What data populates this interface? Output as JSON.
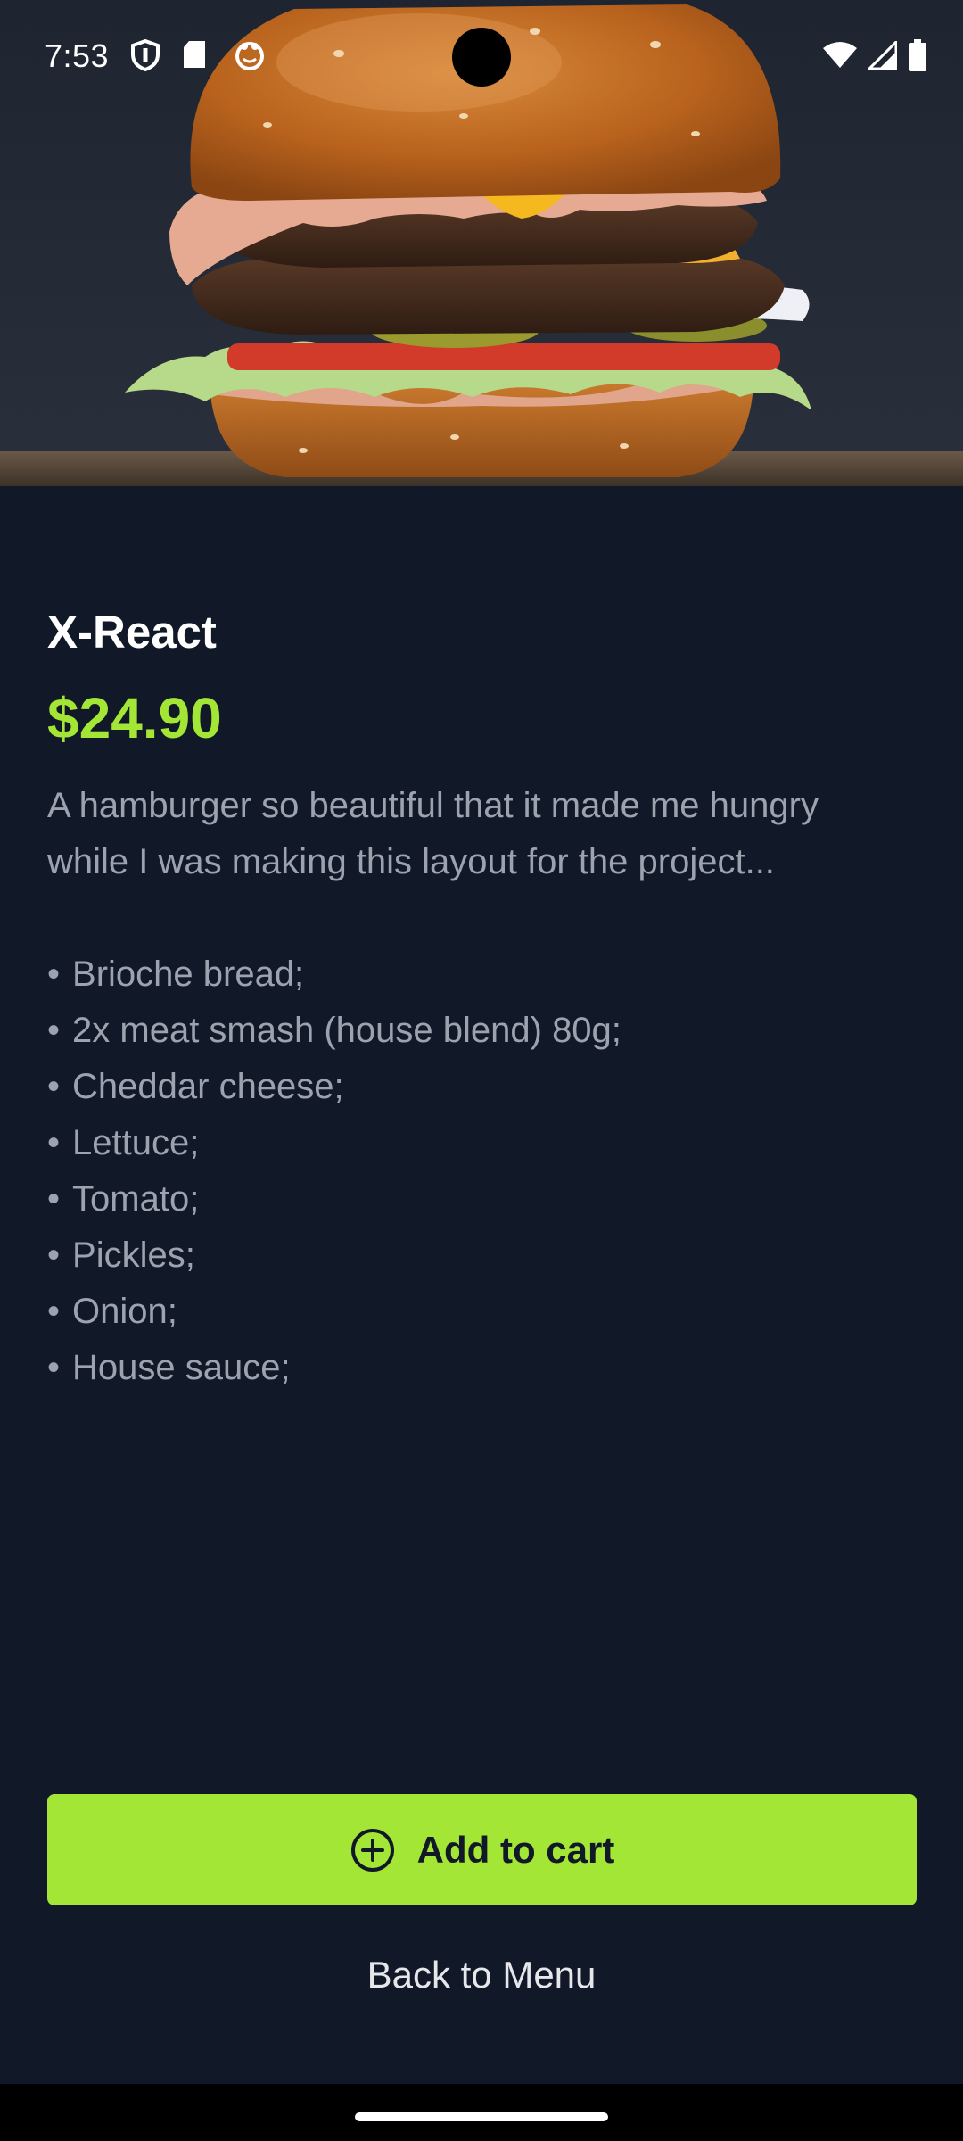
{
  "status_bar": {
    "time": "7:53",
    "left_icons": [
      "shield-icon",
      "sd-card-icon",
      "smiley-icon"
    ],
    "right_icons": [
      "wifi-icon",
      "signal-icon",
      "battery-icon"
    ]
  },
  "hero": {
    "image": "burger-photo"
  },
  "product": {
    "title": "X-React",
    "price": "$24.90",
    "description": "A hamburger so beautiful that it made me hungry while I was making this layout for the project...",
    "ingredients": [
      "Brioche bread;",
      "2x meat smash (house blend) 80g;",
      "Cheddar cheese;",
      "Lettuce;",
      "Tomato;",
      "Pickles;",
      "Onion;",
      "House sauce;"
    ],
    "bullet": "•"
  },
  "actions": {
    "add_to_cart_label": "Add to cart",
    "add_to_cart_icon": "plus-circle-icon",
    "back_label": "Back to Menu"
  },
  "colors": {
    "background": "#111827",
    "accent": "#a3e635",
    "title": "#ffffff",
    "body_text": "#9ca3af"
  }
}
